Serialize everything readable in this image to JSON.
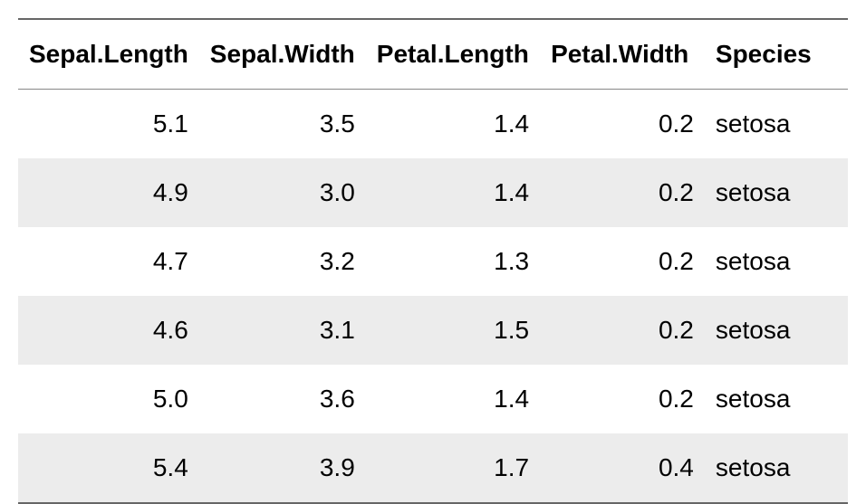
{
  "chart_data": {
    "type": "table",
    "columns": [
      "Sepal.Length",
      "Sepal.Width",
      "Petal.Length",
      "Petal.Width",
      "Species"
    ],
    "rows": [
      [
        "5.1",
        "3.5",
        "1.4",
        "0.2",
        "setosa"
      ],
      [
        "4.9",
        "3.0",
        "1.4",
        "0.2",
        "setosa"
      ],
      [
        "4.7",
        "3.2",
        "1.3",
        "0.2",
        "setosa"
      ],
      [
        "4.6",
        "3.1",
        "1.5",
        "0.2",
        "setosa"
      ],
      [
        "5.0",
        "3.6",
        "1.4",
        "0.2",
        "setosa"
      ],
      [
        "5.4",
        "3.9",
        "1.7",
        "0.4",
        "setosa"
      ]
    ],
    "column_types": [
      "numeric",
      "numeric",
      "numeric",
      "numeric",
      "text"
    ]
  }
}
